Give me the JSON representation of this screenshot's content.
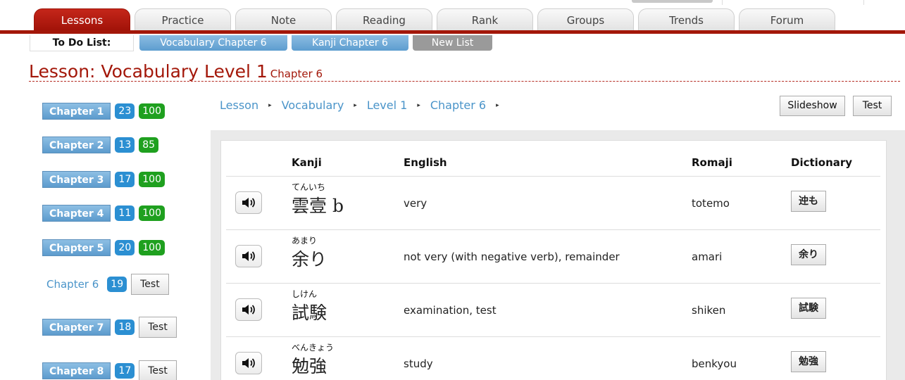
{
  "tabs": [
    "Lessons",
    "Practice",
    "Note",
    "Reading",
    "Rank",
    "Groups",
    "Trends",
    "Forum"
  ],
  "todo": {
    "label": "To Do List:",
    "items": [
      "Vocabulary Chapter 6",
      "Kanji Chapter 6",
      "New List"
    ]
  },
  "title": {
    "main": "Lesson: Vocabulary Level 1",
    "sub": "Chapter 6"
  },
  "sidebar": {
    "chapters": [
      {
        "label": "Chapter 1",
        "count": "23",
        "score": "100"
      },
      {
        "label": "Chapter 2",
        "count": "13",
        "score": "85"
      },
      {
        "label": "Chapter 3",
        "count": "17",
        "score": "100"
      },
      {
        "label": "Chapter 4",
        "count": "11",
        "score": "100"
      },
      {
        "label": "Chapter 5",
        "count": "20",
        "score": "100"
      },
      {
        "label": "Chapter 6",
        "count": "19",
        "test": "Test"
      },
      {
        "label": "Chapter 7",
        "count": "18",
        "test": "Test"
      },
      {
        "label": "Chapter 8",
        "count": "17",
        "test": "Test"
      }
    ]
  },
  "breadcrumb": [
    "Lesson",
    "Vocabulary",
    "Level 1",
    "Chapter 6"
  ],
  "breadcrumb_sep": "▸",
  "actions": {
    "slideshow": "Slideshow",
    "test": "Test"
  },
  "table": {
    "headers": {
      "kanji": "Kanji",
      "english": "English",
      "romaji": "Romaji",
      "dictionary": "Dictionary"
    },
    "rows": [
      {
        "furigana": "てんいち",
        "kanji": "雲壹 b",
        "english": "very",
        "romaji": "totemo",
        "dict": "迚も"
      },
      {
        "furigana": "あまり",
        "kanji": "余り",
        "english": "not very (with negative verb), remainder",
        "romaji": "amari",
        "dict": "余り"
      },
      {
        "furigana": "しけん",
        "kanji": "試験",
        "english": "examination, test",
        "romaji": "shiken",
        "dict": "試験"
      },
      {
        "furigana": "べんきょう",
        "kanji": "勉強",
        "english": "study",
        "romaji": "benkyou",
        "dict": "勉強"
      }
    ]
  }
}
